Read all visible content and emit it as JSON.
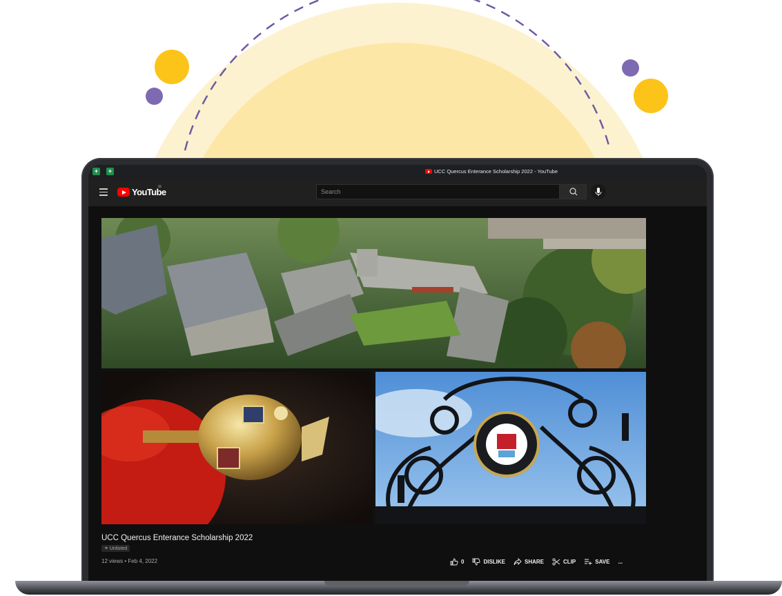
{
  "browser": {
    "tab_title": "UCC Quercus Enterance Scholarship 2022 - YouTube"
  },
  "header": {
    "logo_text": "YouTube",
    "country_code": "IE",
    "search_placeholder": "Search"
  },
  "video": {
    "title": "UCC Quercus Enterance Scholarship 2022",
    "visibility_badge": "Unlisted",
    "stats": "12 views • Feb 4, 2022"
  },
  "actions": {
    "like_count": "0",
    "dislike_label": "DISLIKE",
    "share_label": "SHARE",
    "clip_label": "CLIP",
    "save_label": "SAVE",
    "more_label": "..."
  },
  "colors": {
    "sun_outer": "#fdf2cf",
    "sun_inner": "#fde7a6",
    "dot_yellow": "#fcc419",
    "dot_purple": "#7e6ab0",
    "youtube_red": "#ff0000"
  }
}
